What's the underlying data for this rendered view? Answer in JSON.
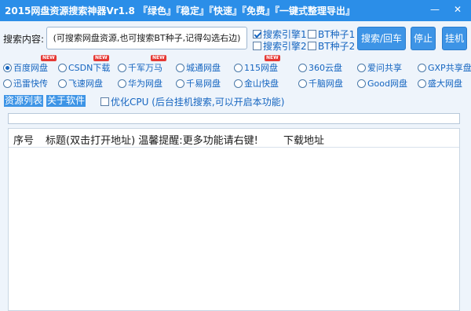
{
  "window": {
    "title": "2015网盘资源搜索神器Vr1.8 『绿色』『稳定』『快速』『免费』『一键式整理导出』",
    "minimize_glyph": "—",
    "close_glyph": "✕"
  },
  "search": {
    "label": "搜索内容:",
    "placeholder": "(可搜索网盘资源,也可搜索BT种子,记得勾选右边)",
    "value": ""
  },
  "engines": [
    {
      "label": "搜索引擎1",
      "checked": true
    },
    {
      "label": "搜索引擎2",
      "checked": false
    }
  ],
  "bt": [
    {
      "label": "BT种子1",
      "checked": false
    },
    {
      "label": "BT种子2",
      "checked": false
    }
  ],
  "buttons": {
    "search": "搜索/回车",
    "stop": "停止",
    "hang": "挂机"
  },
  "sources": [
    {
      "label": "百度网盘",
      "selected": true,
      "new": true
    },
    {
      "label": "CSDN下载",
      "selected": false,
      "new": true
    },
    {
      "label": "千军万马",
      "selected": false,
      "new": true
    },
    {
      "label": "城通网盘",
      "selected": false,
      "new": false
    },
    {
      "label": "115网盘",
      "selected": false,
      "new": true
    },
    {
      "label": "360云盘",
      "selected": false,
      "new": false
    },
    {
      "label": "爱问共享",
      "selected": false,
      "new": false
    },
    {
      "label": "GXP共享盘",
      "selected": false,
      "new": false
    },
    {
      "label": "迅雷快传",
      "selected": false,
      "new": false
    },
    {
      "label": "飞速网盘",
      "selected": false,
      "new": false
    },
    {
      "label": "华为网盘",
      "selected": false,
      "new": false
    },
    {
      "label": "千易网盘",
      "selected": false,
      "new": false
    },
    {
      "label": "金山快盘",
      "selected": false,
      "new": false
    },
    {
      "label": "千脑网盘",
      "selected": false,
      "new": false
    },
    {
      "label": "Good网盘",
      "selected": false,
      "new": false
    },
    {
      "label": "盛大网盘",
      "selected": false,
      "new": false
    }
  ],
  "new_badge": "NEW",
  "tabs": {
    "resources": "资源列表",
    "about": "关于软件"
  },
  "optimize": {
    "label": "优化CPU (后台挂机搜索,可以开启本功能)",
    "checked": false
  },
  "table": {
    "columns": [
      "序号",
      "标题(双击打开地址) 温馨提醒:更多功能请右键!",
      "下载地址"
    ]
  },
  "colors": {
    "titlebar": "#2b8ee8",
    "accent": "#3d94e6",
    "link": "#1565c0",
    "background": "#eef4fb"
  }
}
